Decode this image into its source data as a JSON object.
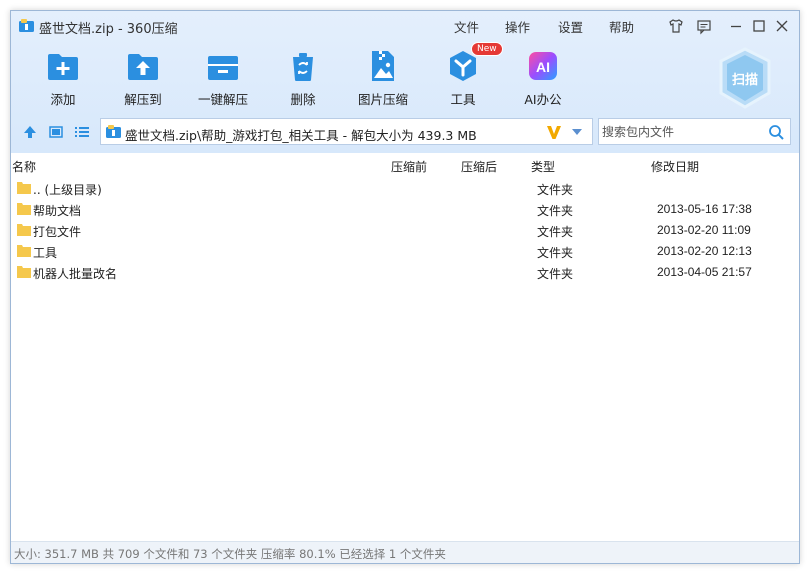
{
  "window": {
    "title": "盛世文档.zip - 360压缩",
    "menu": [
      "文件",
      "操作",
      "设置",
      "帮助"
    ]
  },
  "toolbar": {
    "items": [
      {
        "label": "添加",
        "icon": "add-icon"
      },
      {
        "label": "解压到",
        "icon": "extract-to-icon"
      },
      {
        "label": "一键解压",
        "icon": "one-click-extract-icon"
      },
      {
        "label": "删除",
        "icon": "delete-icon"
      },
      {
        "label": "图片压缩",
        "icon": "image-compress-icon"
      },
      {
        "label": "工具",
        "icon": "tools-icon",
        "badge": "New"
      },
      {
        "label": "AI办公",
        "icon": "ai-office-icon"
      }
    ],
    "scan_label": "扫描"
  },
  "address": {
    "path": "盛世文档.zip\\帮助_游戏打包_相关工具 - 解包大小为 439.3 MB"
  },
  "search": {
    "placeholder": "搜索包内文件"
  },
  "columns": {
    "name": "名称",
    "before": "压缩前",
    "after": "压缩后",
    "type": "类型",
    "modified": "修改日期"
  },
  "files": [
    {
      "name": ".. (上级目录)",
      "type": "文件夹",
      "modified": ""
    },
    {
      "name": "帮助文档",
      "type": "文件夹",
      "modified": "2013-05-16 17:38"
    },
    {
      "name": "打包文件",
      "type": "文件夹",
      "modified": "2013-02-20 11:09"
    },
    {
      "name": "工具",
      "type": "文件夹",
      "modified": "2013-02-20 12:13"
    },
    {
      "name": "机器人批量改名",
      "type": "文件夹",
      "modified": "2013-04-05 21:57"
    }
  ],
  "status": {
    "text": "大小: 351.7 MB 共 709 个文件和 73 个文件夹 压缩率 80.1% 已经选择 1 个文件夹"
  },
  "colors": {
    "accent": "#2b8fe0",
    "chrome": "#dde9f8",
    "folder": "#f5c84c",
    "badge": "#e53935"
  }
}
